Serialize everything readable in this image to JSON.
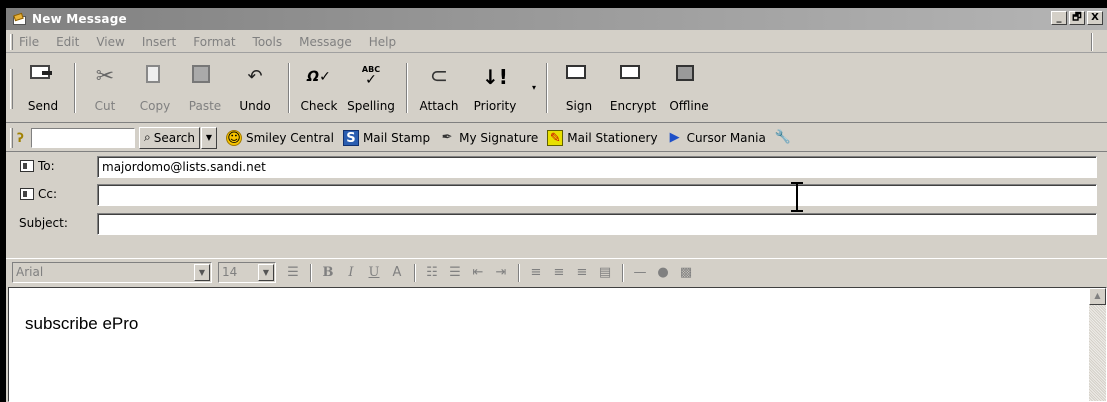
{
  "window": {
    "title": "New Message",
    "controls": {
      "minimize": "_",
      "restore": "🗗",
      "close": "X"
    }
  },
  "menu": [
    "File",
    "Edit",
    "View",
    "Insert",
    "Format",
    "Tools",
    "Message",
    "Help"
  ],
  "toolbar": {
    "send": "Send",
    "cut": "Cut",
    "copy": "Copy",
    "paste": "Paste",
    "undo": "Undo",
    "check": "Check",
    "spelling": "Spelling",
    "attach": "Attach",
    "priority": "Priority",
    "sign": "Sign",
    "encrypt": "Encrypt",
    "offline": "Offline"
  },
  "links": {
    "search_value": "",
    "search_label": "Search",
    "smiley": "Smiley Central",
    "stamp": "Mail Stamp",
    "signature": "My Signature",
    "stationery": "Mail Stationery",
    "cursor": "Cursor Mania"
  },
  "address": {
    "to_label": "To:",
    "to_value": "majordomo@lists.sandi.net",
    "cc_label": "Cc:",
    "cc_value": "",
    "subject_label": "Subject:",
    "subject_value": ""
  },
  "format": {
    "font": "Arial",
    "size": "14"
  },
  "message": {
    "body": "subscribe ePro"
  }
}
